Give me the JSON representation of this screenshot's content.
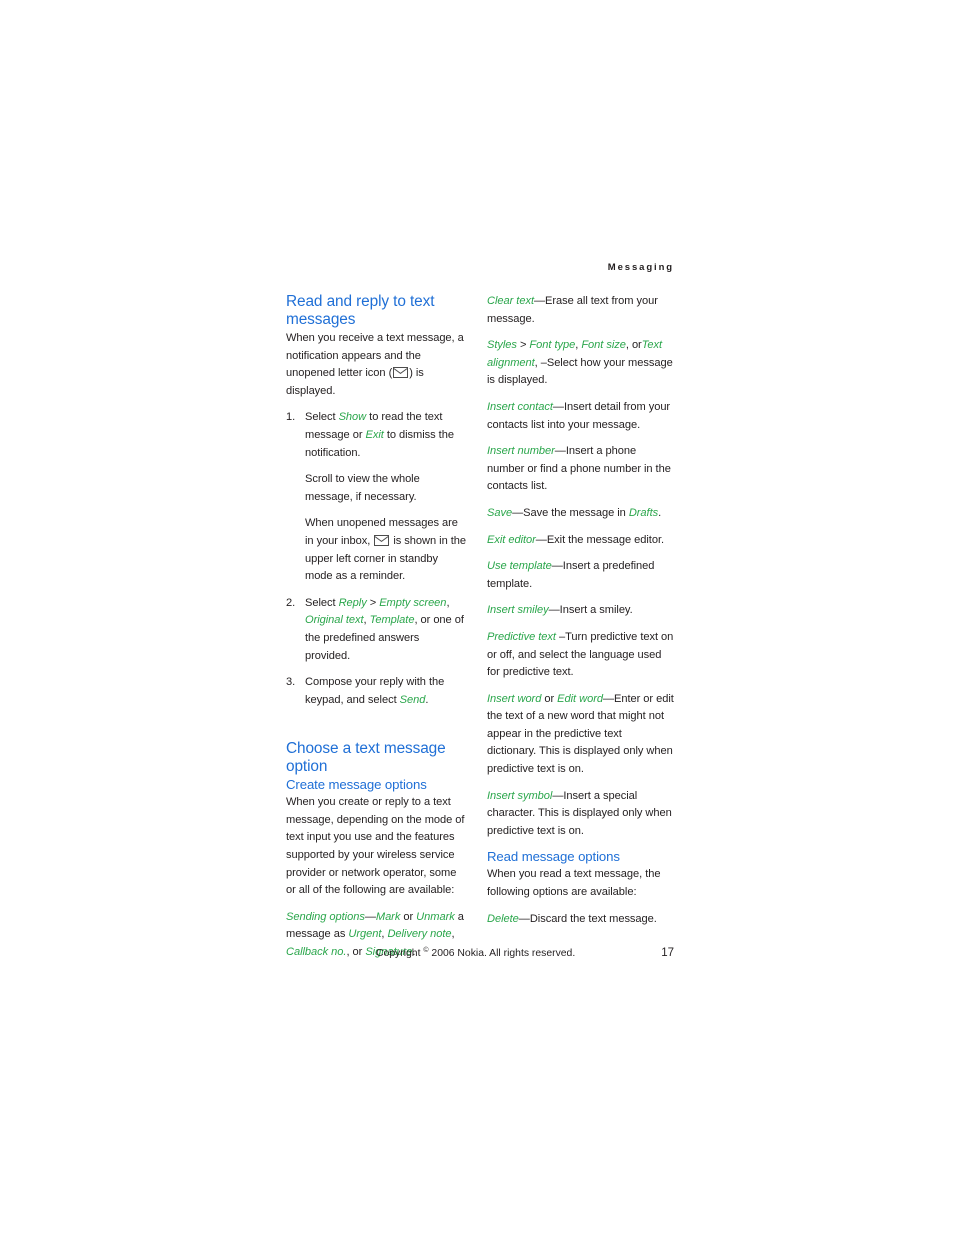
{
  "header": {
    "running_head": "Messaging"
  },
  "colors": {
    "heading_blue": "#1f6fd6",
    "gui_green": "#2aa64b",
    "body_text": "#231f20",
    "page_background": "#ffffff"
  },
  "left_column": {
    "section_heading": "Read and reply to text messages",
    "intro_part1": "When you receive a text message, a notification appears and the unopened letter icon (",
    "intro_part2": ") is displayed.",
    "steps": [
      {
        "num": "1.",
        "paragraphs": [
          {
            "runs": [
              {
                "t": "Select ",
                "s": "plain"
              },
              {
                "t": "Show",
                "s": "gui"
              },
              {
                "t": " to read the text message or ",
                "s": "plain"
              },
              {
                "t": "Exit",
                "s": "gui"
              },
              {
                "t": " to dismiss the notification.",
                "s": "plain"
              }
            ]
          },
          {
            "runs": [
              {
                "t": "Scroll to view the whole message, if necessary.",
                "s": "plain"
              }
            ]
          },
          {
            "icon_para": true,
            "before_icon": "When unopened messages are in your inbox, ",
            "after_icon": " is shown in the upper left corner in standby mode as a reminder."
          }
        ]
      },
      {
        "num": "2.",
        "paragraphs": [
          {
            "runs": [
              {
                "t": "Select ",
                "s": "plain"
              },
              {
                "t": "Reply",
                "s": "gui"
              },
              {
                "t": " > ",
                "s": "plain"
              },
              {
                "t": "Empty screen",
                "s": "gui"
              },
              {
                "t": ", ",
                "s": "plain"
              },
              {
                "t": "Original text",
                "s": "gui"
              },
              {
                "t": ", ",
                "s": "plain"
              },
              {
                "t": "Template",
                "s": "gui"
              },
              {
                "t": ", or one of the predefined answers provided.",
                "s": "plain"
              }
            ]
          }
        ]
      },
      {
        "num": "3.",
        "paragraphs": [
          {
            "runs": [
              {
                "t": "Compose your reply with the keypad, and select ",
                "s": "plain"
              },
              {
                "t": "Send",
                "s": "gui"
              },
              {
                "t": ".",
                "s": "plain"
              }
            ]
          }
        ]
      }
    ],
    "section_heading_2": "Choose a text message option",
    "sub_heading_1": "Create message options",
    "create_intro": "When you create or reply to a text message, depending on the mode of text input you use and the features supported by your wireless service provider or network operator, some or all of the following are available:",
    "option_sending": {
      "runs": [
        {
          "t": "Sending options",
          "s": "gui"
        },
        {
          "t": "—",
          "s": "plain"
        },
        {
          "t": "Mark",
          "s": "gui"
        },
        {
          "t": " or ",
          "s": "plain"
        },
        {
          "t": "Unmark",
          "s": "gui"
        },
        {
          "t": " a message as ",
          "s": "plain"
        },
        {
          "t": "Urgent",
          "s": "gui"
        },
        {
          "t": ", ",
          "s": "plain"
        },
        {
          "t": "Delivery note",
          "s": "gui"
        },
        {
          "t": ", ",
          "s": "plain"
        },
        {
          "t": "Callback no.",
          "s": "gui"
        },
        {
          "t": ", or ",
          "s": "plain"
        },
        {
          "t": "Signature",
          "s": "gui"
        },
        {
          "t": ".",
          "s": "plain"
        }
      ]
    }
  },
  "right_column": {
    "options": [
      {
        "name": "clear-text",
        "runs": [
          {
            "t": "Clear text",
            "s": "gui"
          },
          {
            "t": "—Erase all text from your message.",
            "s": "plain"
          }
        ]
      },
      {
        "name": "styles",
        "runs": [
          {
            "t": "Styles",
            "s": "gui"
          },
          {
            "t": " > ",
            "s": "plain"
          },
          {
            "t": "Font type",
            "s": "gui"
          },
          {
            "t": ", ",
            "s": "plain"
          },
          {
            "t": "Font size",
            "s": "gui"
          },
          {
            "t": ", or",
            "s": "plain"
          },
          {
            "t": "Text alignment",
            "s": "gui"
          },
          {
            "t": ", –Select how your message is displayed.",
            "s": "plain"
          }
        ]
      },
      {
        "name": "insert-contact",
        "runs": [
          {
            "t": "Insert contact",
            "s": "gui"
          },
          {
            "t": "—Insert detail from your contacts list into your message.",
            "s": "plain"
          }
        ]
      },
      {
        "name": "insert-number",
        "runs": [
          {
            "t": "Insert number",
            "s": "gui"
          },
          {
            "t": "—Insert a phone number or find a phone number in the contacts list.",
            "s": "plain"
          }
        ]
      },
      {
        "name": "save",
        "runs": [
          {
            "t": "Save",
            "s": "gui"
          },
          {
            "t": "—Save the message in ",
            "s": "plain"
          },
          {
            "t": "Drafts",
            "s": "gui"
          },
          {
            "t": ".",
            "s": "plain"
          }
        ]
      },
      {
        "name": "exit-editor",
        "runs": [
          {
            "t": "Exit editor",
            "s": "gui"
          },
          {
            "t": "—Exit the message editor.",
            "s": "plain"
          }
        ]
      },
      {
        "name": "use-template",
        "runs": [
          {
            "t": "Use template",
            "s": "gui"
          },
          {
            "t": "—Insert a predefined template.",
            "s": "plain"
          }
        ]
      },
      {
        "name": "insert-smiley",
        "runs": [
          {
            "t": "Insert smiley",
            "s": "gui"
          },
          {
            "t": "—Insert a smiley.",
            "s": "plain"
          }
        ]
      },
      {
        "name": "predictive-text",
        "runs": [
          {
            "t": "Predictive text",
            "s": "gui"
          },
          {
            "t": " –Turn predictive text on or off, and select the language used for predictive text.",
            "s": "plain"
          }
        ]
      },
      {
        "name": "insert-word",
        "runs": [
          {
            "t": "Insert word",
            "s": "gui"
          },
          {
            "t": " or ",
            "s": "plain"
          },
          {
            "t": "Edit word",
            "s": "gui"
          },
          {
            "t": "—Enter or edit the text of a new word that might not appear in the predictive text dictionary. This is displayed only when predictive text is on.",
            "s": "plain"
          }
        ]
      },
      {
        "name": "insert-symbol",
        "runs": [
          {
            "t": "Insert symbol",
            "s": "gui"
          },
          {
            "t": "—Insert a special character. This is displayed only when predictive text is on.",
            "s": "plain"
          }
        ]
      }
    ],
    "sub_heading_read": "Read message options",
    "read_intro": "When you read a text message, the following options are available:",
    "read_options": [
      {
        "name": "delete",
        "runs": [
          {
            "t": "Delete",
            "s": "gui"
          },
          {
            "t": "—Discard the text message.",
            "s": "plain"
          }
        ]
      }
    ]
  },
  "footer": {
    "copyright_before": "Copyright ",
    "copyright_symbol": "©",
    "copyright_after": " 2006 Nokia. All rights reserved.",
    "page_number": "17"
  }
}
